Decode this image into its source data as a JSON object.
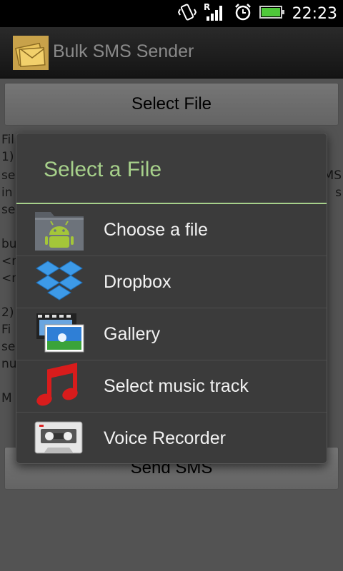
{
  "status_bar": {
    "time": "22:23",
    "icons": [
      "vibrate-icon",
      "roaming-signal-icon",
      "alarm-icon",
      "battery-icon"
    ]
  },
  "app": {
    "title": "Bulk SMS Sender",
    "icon": "envelope-icon"
  },
  "background": {
    "select_file_label": "Select File",
    "send_sms_label": "Send SMS",
    "peek_lines_left": [
      "Fil",
      "1)",
      "se",
      "in",
      "se",
      "bu",
      "<m",
      "<m",
      "2)",
      "Fi",
      "se",
      "nu",
      "M"
    ],
    "peek_lines_right": [
      "MS",
      "s"
    ]
  },
  "dialog": {
    "title": "Select a File",
    "accent": "#a7d18b",
    "items": [
      {
        "label": "Choose a file",
        "icon": "android-folder-icon"
      },
      {
        "label": "Dropbox",
        "icon": "dropbox-icon"
      },
      {
        "label": "Gallery",
        "icon": "gallery-icon"
      },
      {
        "label": "Select music track",
        "icon": "music-note-icon"
      },
      {
        "label": "Voice Recorder",
        "icon": "cassette-icon"
      }
    ]
  }
}
